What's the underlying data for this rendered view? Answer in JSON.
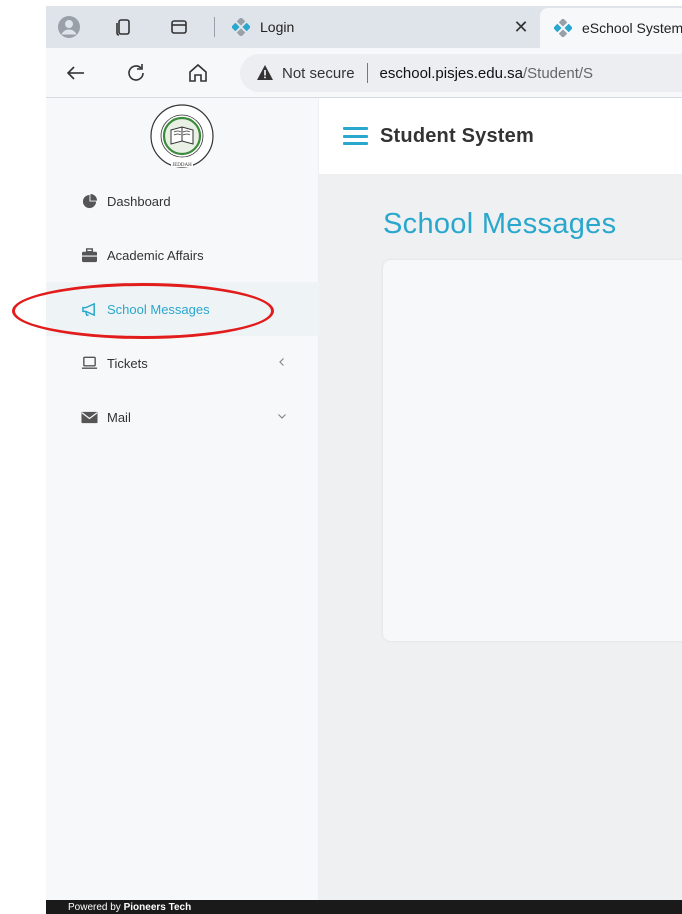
{
  "browser": {
    "tabs": [
      {
        "title": "Login",
        "active": false
      },
      {
        "title": "eSchool System",
        "active": true
      }
    ],
    "address": {
      "security_label": "Not secure",
      "host": "eschool.pisjes.edu.sa",
      "path": "/Student/S"
    }
  },
  "sidebar": {
    "logo_alt": "Pakistan International School Jeddah",
    "items": [
      {
        "label": "Dashboard",
        "icon": "pie-chart-icon",
        "active": false
      },
      {
        "label": "Academic Affairs",
        "icon": "briefcase-icon",
        "active": false
      },
      {
        "label": "School Messages",
        "icon": "megaphone-icon",
        "active": true
      },
      {
        "label": "Tickets",
        "icon": "laptop-icon",
        "active": false,
        "caret": "chevron-left-icon"
      },
      {
        "label": "Mail",
        "icon": "envelope-icon",
        "active": false,
        "caret": "chevron-down-icon"
      }
    ]
  },
  "header": {
    "title": "Student System"
  },
  "main": {
    "page_title": "School Messages"
  },
  "footer": {
    "prefix": "Powered by ",
    "brand": "Pioneers Tech"
  },
  "colors": {
    "accent": "#2aa7cc",
    "highlight_oval": "#e21b1b",
    "footer_bg": "#1a1a1a"
  }
}
